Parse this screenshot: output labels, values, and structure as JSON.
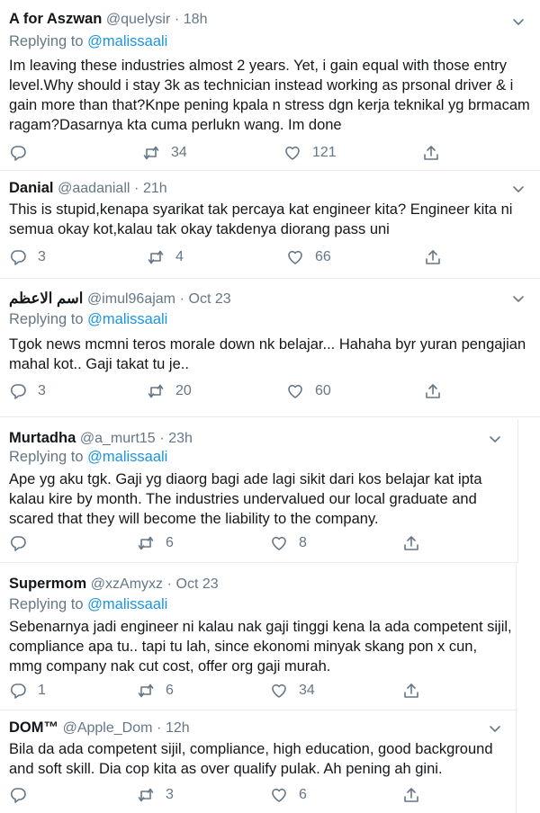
{
  "tweets": [
    {
      "name": "A for Aszwan",
      "handle": "@quelysir",
      "time": "18h",
      "reply_prefix": "Replying to",
      "reply_to": "@malissaali",
      "text": "Im leaving these industries almost 2 years. Yet, i gain equal with those entry level.Why should i stay 3k as technician instead working as prsonal driver & i gain more than that?Knpe pening kpala n stress dgn kerja teknikal yg brmacam ragam?Dasarnya kta cuma perlukn wang. Im done",
      "replies": "",
      "retweets": "34",
      "likes": "121"
    },
    {
      "name": "Danial",
      "handle": "@aadaniall",
      "time": "21h",
      "reply_prefix": "",
      "reply_to": "",
      "text": "This is stupid,kenapa syarikat tak percaya kat engineer kita? Engineer kita ni semua okay kot,kalau tak okay takdenya diorang pass uni",
      "replies": "3",
      "retweets": "4",
      "likes": "66"
    },
    {
      "name": "اسم الاعظم",
      "handle": "@imul96ajam",
      "time": "Oct 23",
      "reply_prefix": "Replying to",
      "reply_to": "@malissaali",
      "text": "Tgok news mcmni teros morale down nk belajar... Hahaha byr yuran pengajian mahal kot.. Gaji takat tu je..",
      "replies": "3",
      "retweets": "20",
      "likes": "60"
    },
    {
      "name": "Murtadha",
      "handle": "@a_murt15",
      "time": "23h",
      "reply_prefix": "Replying to",
      "reply_to": "@malissaali",
      "text": "Ape yg aku tgk. Gaji yg diaorg bagi ade lagi sikit dari kos belajar kat ipta kalau kire by month. The industries  undervalued our local graduate and scared that they will become the liability to the company.",
      "replies": "",
      "retweets": "6",
      "likes": "8"
    },
    {
      "name": "Supermom",
      "handle": "@xzAmyxz",
      "time": "Oct 23",
      "reply_prefix": "Replying to",
      "reply_to": "@malissaali",
      "text": "Sebenarnya jadi engineer ni kalau nak gaji tinggi kena la ada competent sijil, compliance apa tu.. tapi tu lah, since ekonomi minyak skang pon x cun, mmg company nak cut cost, offer org gaji murah.",
      "replies": "1",
      "retweets": "6",
      "likes": "34"
    },
    {
      "name": "DOM™",
      "handle": "@Apple_Dom",
      "time": "12h",
      "reply_prefix": "",
      "reply_to": "",
      "text": "Bila da ada competent sijil, compliance, high education, good background and soft skill. Dia cop kita as over qualify pulak. Ah pening ah gini.",
      "replies": "",
      "retweets": "3",
      "likes": "6"
    }
  ],
  "colors": {
    "link": "#1b95e0",
    "muted": "#657786",
    "text": "#14171a",
    "divider": "#e6ecf0"
  }
}
